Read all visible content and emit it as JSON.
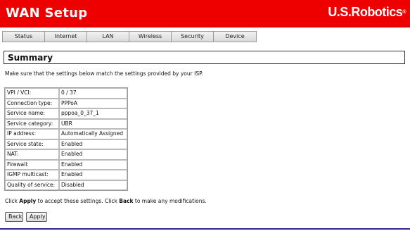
{
  "header": {
    "title": "WAN Setup",
    "brand": "U.S.Robotics",
    "brand_mark": "®"
  },
  "nav": {
    "tabs": [
      {
        "label": "Status"
      },
      {
        "label": "Internet"
      },
      {
        "label": "LAN"
      },
      {
        "label": "Wireless"
      },
      {
        "label": "Security"
      },
      {
        "label": "Device"
      }
    ]
  },
  "summary": {
    "title": "Summary",
    "intro": "Make sure that the settings below match the settings provided by your ISP."
  },
  "settings": [
    {
      "label": "VPI / VCI:",
      "value": "0 / 37"
    },
    {
      "label": "Connection type:",
      "value": "PPPoA"
    },
    {
      "label": "Service name:",
      "value": "pppoa_0_37_1"
    },
    {
      "label": "Service category:",
      "value": "UBR"
    },
    {
      "label": "IP address:",
      "value": "Automatically Assigned"
    },
    {
      "label": "Service state:",
      "value": "Enabled"
    },
    {
      "label": "NAT:",
      "value": "Enabled"
    },
    {
      "label": "Firewall:",
      "value": "Enabled"
    },
    {
      "label": "IGMP multicast:",
      "value": "Enabled"
    },
    {
      "label": "Quality of service:",
      "value": "Disabled"
    }
  ],
  "footer_note": {
    "part1": "Click ",
    "apply_word": "Apply",
    "part2": " to accept these settings. Click ",
    "back_word": "Back",
    "part3": " to make any modifications."
  },
  "buttons": {
    "back_label": "Back",
    "apply_label": "Apply"
  },
  "colors": {
    "header_bg": "#ee0000",
    "bottom_line": "#2a2a8a"
  }
}
